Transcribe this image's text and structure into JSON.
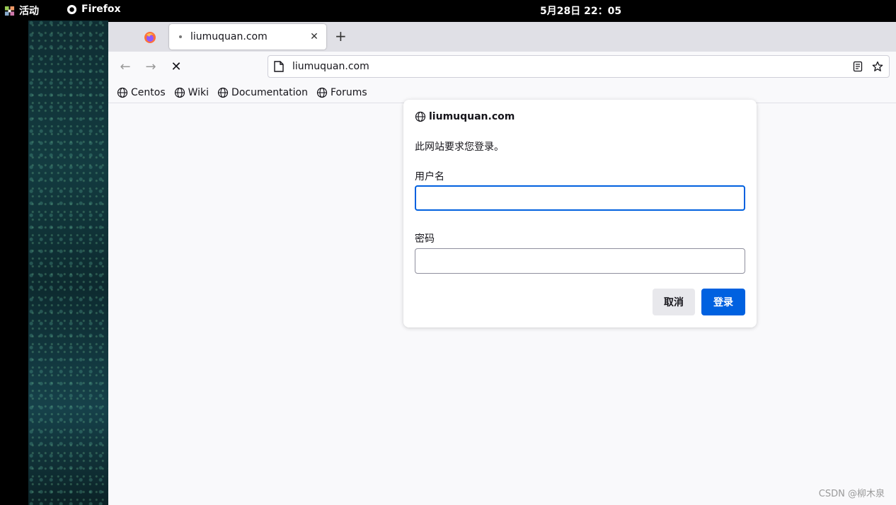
{
  "system": {
    "activities_label": "活动",
    "app_label": "Firefox",
    "clock": "5月28日  22：05"
  },
  "browser": {
    "tab_title": "liumuquan.com",
    "tab_close_glyph": "✕",
    "new_tab_glyph": "+",
    "url": "liumuquan.com",
    "nav": {
      "back_glyph": "←",
      "forward_glyph": "→",
      "stop_glyph": "✕"
    },
    "bookmarks": [
      {
        "label": "Centos"
      },
      {
        "label": "Wiki"
      },
      {
        "label": "Documentation"
      },
      {
        "label": "Forums"
      }
    ]
  },
  "dialog": {
    "site": "liumuquan.com",
    "message": "此网站要求您登录。",
    "username_label": "用户名",
    "username_value": "",
    "password_label": "密码",
    "password_value": "",
    "cancel_label": "取消",
    "login_label": "登录",
    "accent": "#0061e0"
  },
  "watermark": "CSDN @柳木泉"
}
